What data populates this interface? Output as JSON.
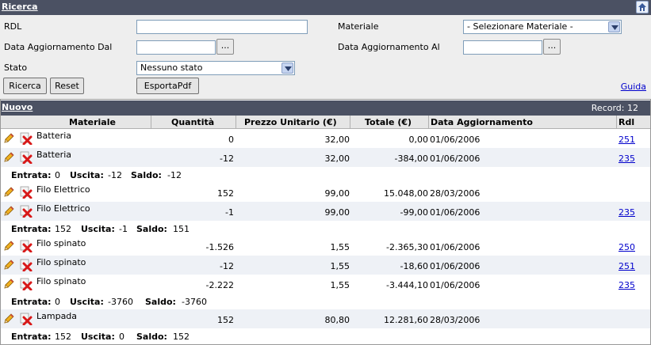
{
  "search": {
    "title": "Ricerca",
    "rdl_label": "RDL",
    "rdl_value": "",
    "materiale_label": "Materiale",
    "materiale_selected": "- Selezionare Materiale -",
    "data_dal_label": "Data Aggiornamento Dal",
    "data_dal_value": "",
    "data_al_label": "Data Aggiornamento Al",
    "data_al_value": "",
    "dots_label": "...",
    "stato_label": "Stato",
    "stato_selected": "Nessuno stato",
    "btn_ricerca": "Ricerca",
    "btn_reset": "Reset",
    "btn_esporta": "EsportaPdf",
    "guida": "Guida"
  },
  "list": {
    "nuovo": "Nuovo",
    "record_label": "Record: 12",
    "columns": {
      "materiale": "Materiale",
      "quantita": "Quantità",
      "prezzo": "Prezzo Unitario (€)",
      "totale": "Totale (€)",
      "data": "Data Aggiornamento",
      "rdl": "Rdl"
    },
    "groups": [
      {
        "rows": [
          {
            "materiale": "Batteria",
            "quantita": "0",
            "prezzo": "32,00",
            "totale": "0,00",
            "data": "01/06/2006",
            "rdl": "251"
          },
          {
            "materiale": "Batteria",
            "quantita": "-12",
            "prezzo": "32,00",
            "totale": "-384,00",
            "data": "01/06/2006",
            "rdl": "235"
          }
        ],
        "summary": {
          "entrata_label": "Entrata:",
          "entrata": "0",
          "uscita_label": "Uscita:",
          "uscita": "-12",
          "saldo_label": "Saldo:",
          "saldo": "-12"
        }
      },
      {
        "rows": [
          {
            "materiale": "Filo Elettrico",
            "quantita": "152",
            "prezzo": "99,00",
            "totale": "15.048,00",
            "data": "28/03/2006",
            "rdl": ""
          },
          {
            "materiale": "Filo Elettrico",
            "quantita": "-1",
            "prezzo": "99,00",
            "totale": "-99,00",
            "data": "01/06/2006",
            "rdl": "235"
          }
        ],
        "summary": {
          "entrata_label": "Entrata:",
          "entrata": "152",
          "uscita_label": "Uscita:",
          "uscita": "-1",
          "saldo_label": "Saldo:",
          "saldo": "151"
        }
      },
      {
        "rows": [
          {
            "materiale": "Filo spinato",
            "quantita": "-1.526",
            "prezzo": "1,55",
            "totale": "-2.365,30",
            "data": "01/06/2006",
            "rdl": "250"
          },
          {
            "materiale": "Filo spinato",
            "quantita": "-12",
            "prezzo": "1,55",
            "totale": "-18,60",
            "data": "01/06/2006",
            "rdl": "251"
          },
          {
            "materiale": "Filo spinato",
            "quantita": "-2.222",
            "prezzo": "1,55",
            "totale": "-3.444,10",
            "data": "01/06/2006",
            "rdl": "235"
          }
        ],
        "summary": {
          "entrata_label": "Entrata:",
          "entrata": "0",
          "uscita_label": "Uscita:",
          "uscita": "-3760",
          "saldo_label": "Saldo:",
          "saldo": "-3760"
        }
      },
      {
        "rows": [
          {
            "materiale": "Lampada",
            "quantita": "152",
            "prezzo": "80,80",
            "totale": "12.281,60",
            "data": "28/03/2006",
            "rdl": ""
          }
        ],
        "summary": {
          "entrata_label": "Entrata:",
          "entrata": "152",
          "uscita_label": "Uscita:",
          "uscita": "0",
          "saldo_label": "Saldo:",
          "saldo": "152"
        }
      }
    ]
  }
}
